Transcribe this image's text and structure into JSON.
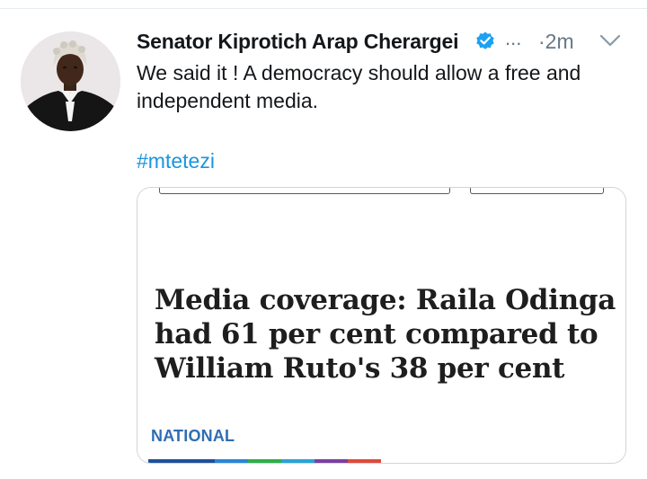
{
  "tweet": {
    "author": {
      "display_name": "Senator Kiprotich Arap Cherargei",
      "verified": true,
      "avatar": "avatar-photo"
    },
    "overflow_label": "...",
    "time_ago": "·2m",
    "text": "We said it ! A democracy should allow a free and independent media.",
    "hashtag": "#mtetezi",
    "card": {
      "headline": "Media coverage: Raila Odinga had 61 per cent compared to William Ruto's 38 per cent",
      "section": "NATIONAL",
      "strip_colors": [
        "#1f4e9a",
        "#1f4e9a",
        "#2a86d8",
        "#2fae4a",
        "#29a3d6",
        "#7a3fa0",
        "#e04a3a"
      ]
    }
  },
  "colors": {
    "verified": "#1da1f2",
    "link": "#1b95e0",
    "muted": "#657786",
    "section": "#2f6db1"
  },
  "icons": {
    "verified": "verified-badge-icon",
    "menu": "chevron-down-icon"
  }
}
